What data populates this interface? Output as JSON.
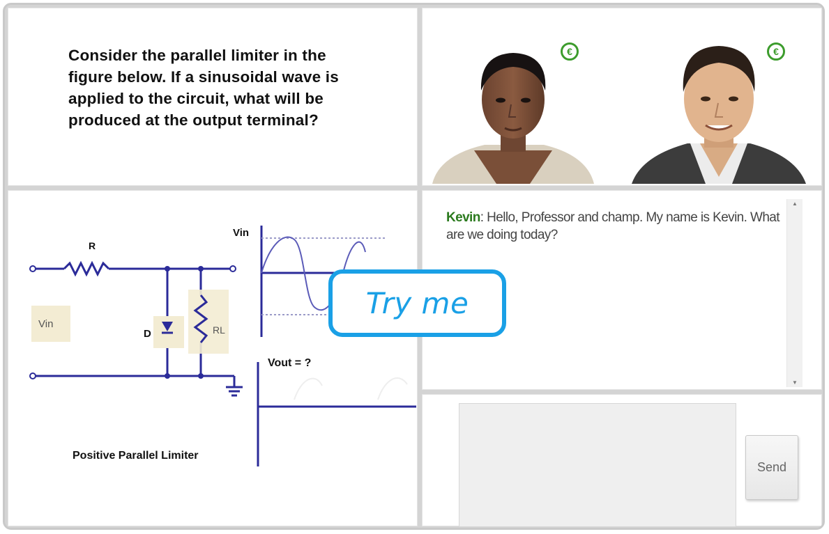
{
  "question": {
    "text": "Consider the parallel limiter in the figure below. If a sinusoidal wave is applied to the circuit, what will be produced at the output terminal?"
  },
  "avatars": {
    "left": {
      "icon": "speaker-icon"
    },
    "right": {
      "icon": "speaker-icon"
    }
  },
  "figure": {
    "resistor_label": "R",
    "vin_box_label": "Vin",
    "diode_label": "D",
    "load_label": "RL",
    "vin_axis_label": "Vin",
    "vout_axis_label": "Vout = ?",
    "caption": "Positive Parallel Limiter"
  },
  "chat": {
    "messages": [
      {
        "speaker": "Kevin",
        "text": ": Hello, Professor and champ. My name is Kevin. What are we doing today?"
      }
    ]
  },
  "input": {
    "value": "",
    "send_label": "Send"
  },
  "overlay": {
    "try_me_label": "Try me"
  },
  "colors": {
    "accent": "#1aa0e6",
    "circuit": "#2b2b99",
    "speaker_name": "#2b7a1e",
    "label_box": "#f3ecd3"
  }
}
